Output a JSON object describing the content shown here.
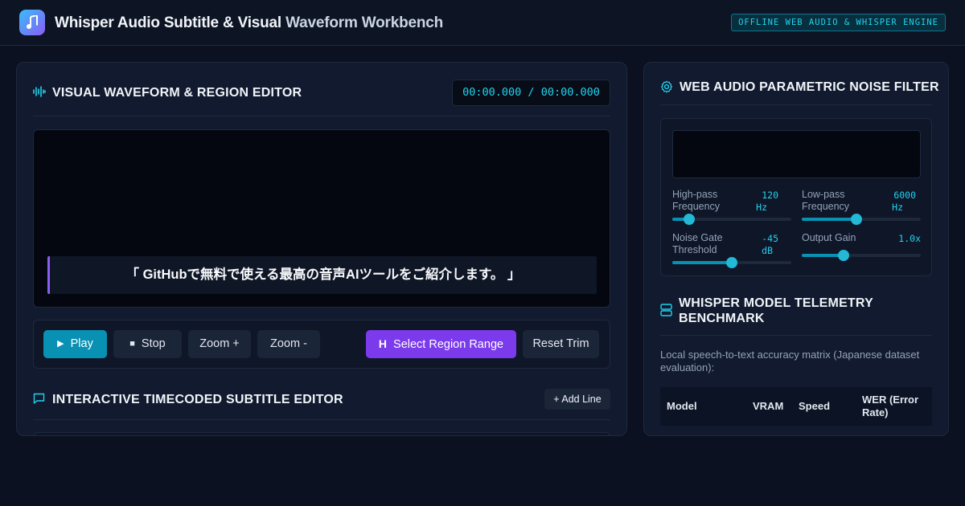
{
  "header": {
    "title_main": "Whisper Audio Subtitle & Visual",
    "title_muted": "Waveform Workbench",
    "badge": "OFFLINE WEB AUDIO & WHISPER ENGINE"
  },
  "waveform": {
    "title": "VISUAL WAVEFORM & REGION EDITOR",
    "timecode": "00:00.000 / 00:00.000",
    "subtitle_preview": "「 GitHubで無料で使える最高の音声AIツールをご紹介します。 」"
  },
  "transport": {
    "play": "Play",
    "stop": "Stop",
    "zoom_in": "Zoom +",
    "zoom_out": "Zoom -",
    "select_region": "Select Region Range",
    "reset_trim": "Reset Trim"
  },
  "subtitle_editor": {
    "title": "INTERACTIVE TIMECODED SUBTITLE EDITOR",
    "add_line": "+ Add Line"
  },
  "noise_filter": {
    "title": "WEB AUDIO PARAMETRIC NOISE FILTER",
    "controls": [
      {
        "label": "High-pass Frequency",
        "value": "120",
        "unit": "Hz",
        "level": 0.14
      },
      {
        "label": "Low-pass Frequency",
        "value": "6000",
        "unit": "Hz",
        "level": 0.46
      },
      {
        "label": "Noise Gate Threshold",
        "value": "-45",
        "unit": "dB",
        "level": 0.5
      },
      {
        "label": "Output Gain",
        "value": "1.0x",
        "unit": "",
        "level": 0.35
      }
    ]
  },
  "telemetry": {
    "title_line1": "WHISPER MODEL TELEMETRY",
    "title_line2": "BENCHMARK",
    "description": "Local speech-to-text accuracy matrix (Japanese dataset evaluation):",
    "columns": [
      "Model",
      "VRAM",
      "Speed",
      "WER (Error Rate)"
    ]
  },
  "colors": {
    "accent_cyan": "#22d3ee",
    "accent_violet": "#7c3aed",
    "background": "#0b1120"
  }
}
